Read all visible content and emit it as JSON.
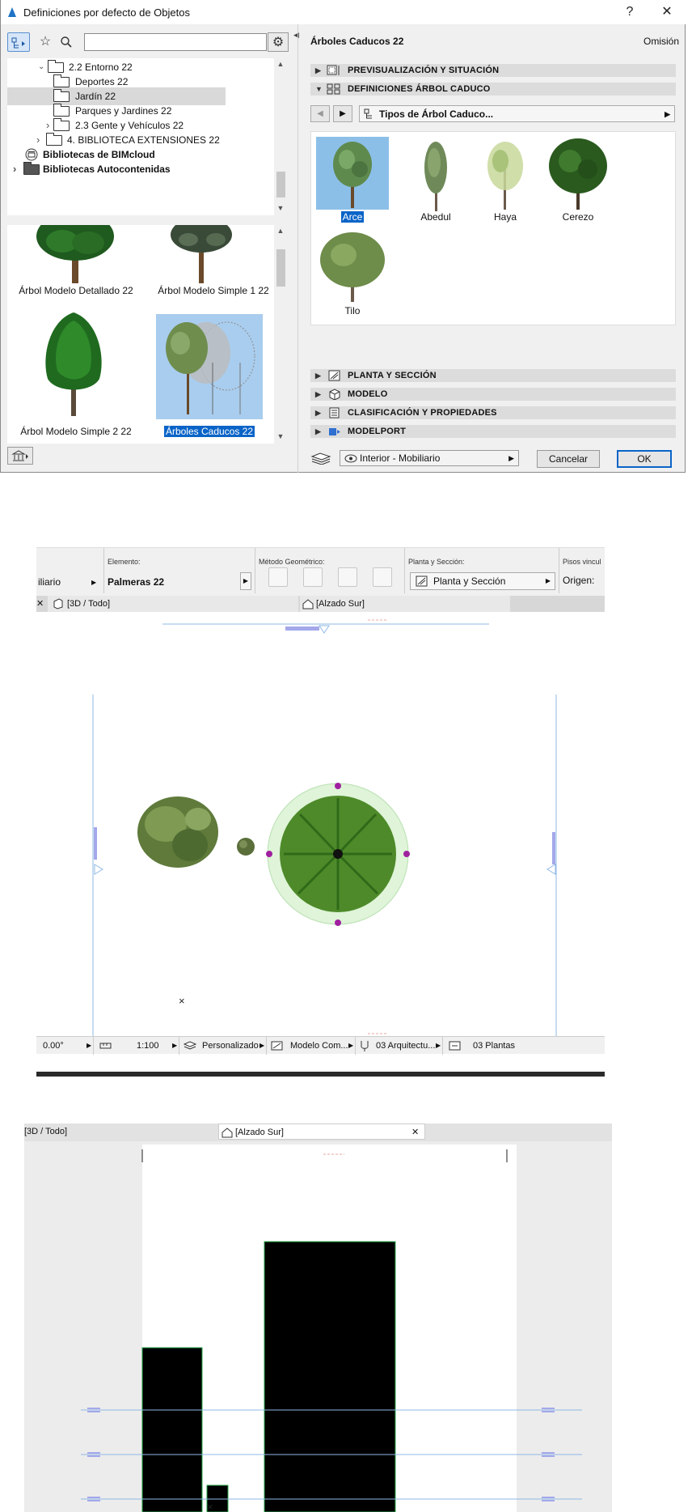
{
  "dialog": {
    "title": "Definiciones por defecto de Objetos",
    "help": "?",
    "close": "✕",
    "search": {
      "value": "",
      "placeholder": ""
    },
    "tree": [
      {
        "label": "2.2 Entorno 22",
        "chevron": "⌄"
      },
      {
        "label": "Deportes 22"
      },
      {
        "label": "Jardín 22"
      },
      {
        "label": "Parques y Jardines 22"
      },
      {
        "label": "2.3 Gente y Vehículos 22",
        "chevron": "›"
      },
      {
        "label": "4. BIBLIOTECA EXTENSIONES 22",
        "chevron": "›"
      },
      {
        "label": "Bibliotecas de BIMcloud"
      },
      {
        "label": "Bibliotecas Autocontenidas",
        "chevron": "›"
      }
    ],
    "thumbnails": [
      "Árbol Modelo Detallado 22",
      "Árbol Modelo Simple 1 22",
      "Árbol Modelo Simple 2 22",
      "Árboles Caducos 22"
    ],
    "right_title": "Árboles Caducos 22",
    "omission": "Omisión",
    "sections_top": [
      "PREVISUALIZACIÓN Y SITUACIÓN",
      "DEFINICIONES ÁRBOL CADUCO"
    ],
    "sections_bottom": [
      "PLANTA Y SECCIÓN",
      "MODELO",
      "CLASIFICACIÓN Y PROPIEDADES",
      "MODELPORT"
    ],
    "type_select": "Tipos de Árbol Caduco...",
    "tree_types": [
      "Arce",
      "Abedul",
      "Haya",
      "Cerezo",
      "Tilo"
    ],
    "vista": "Interior - Mobiliario",
    "cancel": "Cancelar",
    "ok": "OK"
  },
  "info_bar": {
    "truncated_left": "iliario",
    "element_label": "Elemento:",
    "element_value": "Palmeras 22",
    "geom_label": "Método Geométrico:",
    "plan_label": "Planta y Sección:",
    "plan_value": "Planta y Sección",
    "pisos_label": "Pisos vincul",
    "origen_label": "Origen:",
    "tab1": "[3D / Todo]",
    "tab2": "[Alzado Sur]"
  },
  "plan_status": {
    "angle": "0.00°",
    "scale": "1:100",
    "layer_combo": "Personalizado",
    "model": "Modelo Com...",
    "pen": "03 Arquitectu...",
    "stories": "03 Plantas"
  },
  "elevation": {
    "tab1": "[3D / Todo]",
    "tab2": "[Alzado Sur]",
    "close": "✕"
  },
  "colors": {
    "selection": "#0a64c8",
    "guide": "#8fb8e6",
    "palm_marker": "#a020a0"
  }
}
